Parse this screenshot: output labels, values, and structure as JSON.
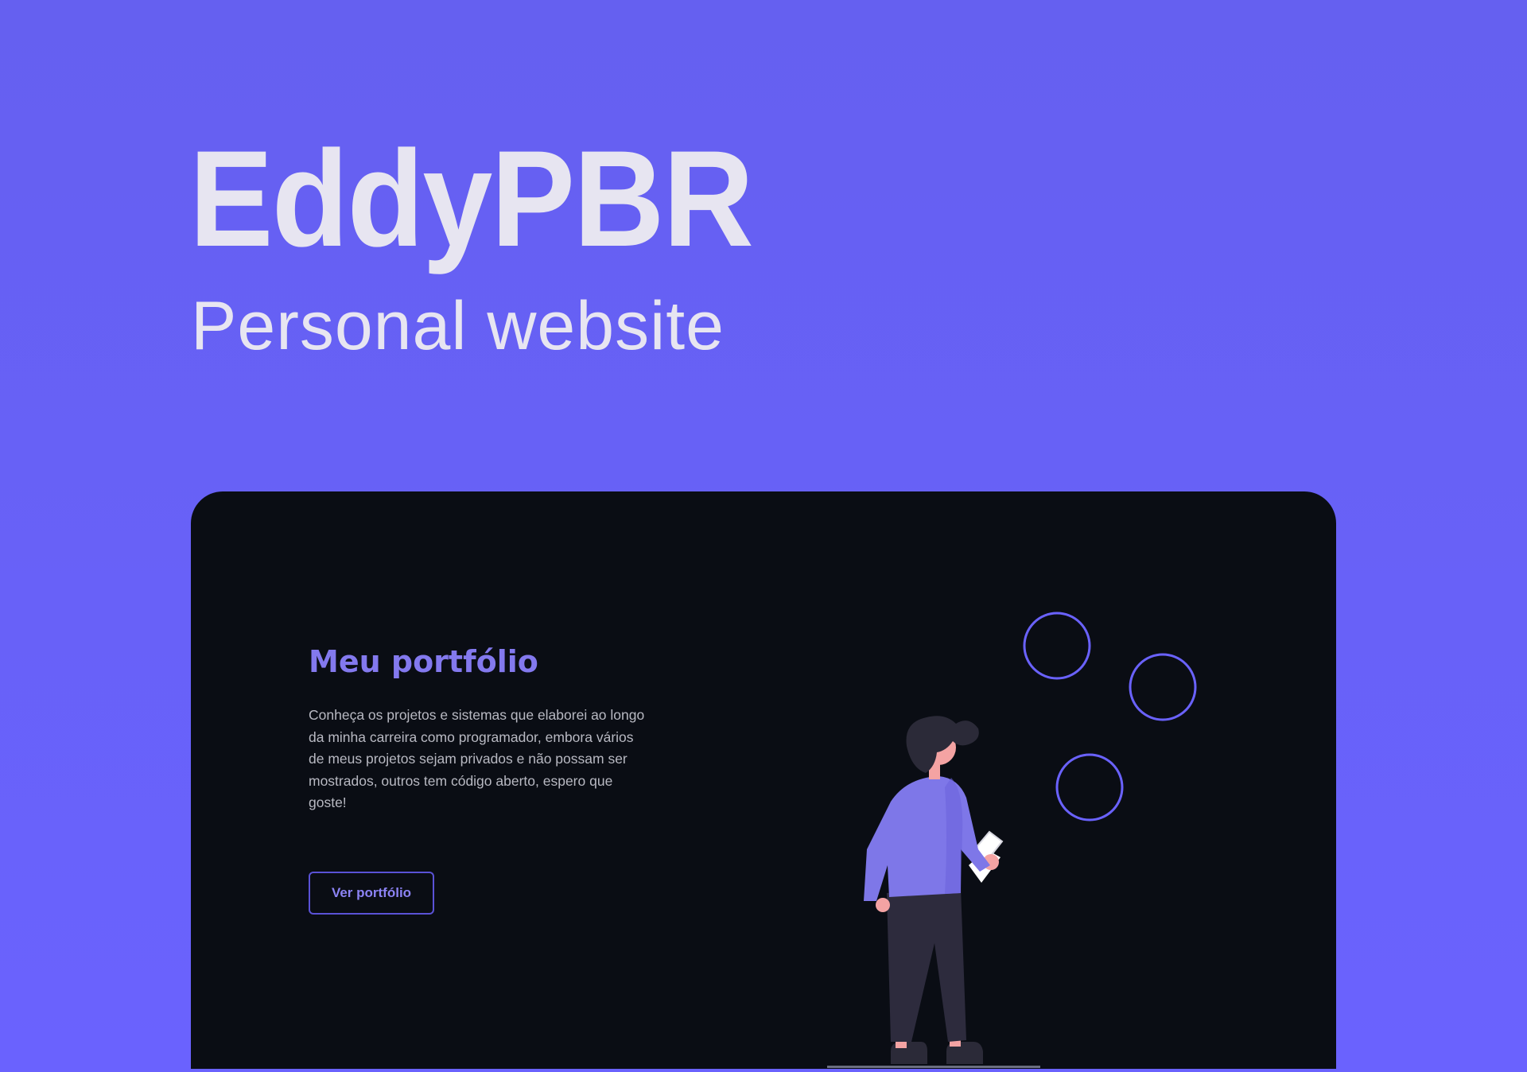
{
  "hero": {
    "title": "EddyPBR",
    "subtitle": "Personal website"
  },
  "preview": {
    "heading": "Meu portfólio",
    "description": "Conheça os projetos e sistemas que elaborei ao longo da minha carreira como programador, embora vários de meus projetos sejam privados e não possam ser mostrados, outros tem código aberto, espero que goste!",
    "button_label": "Ver portfólio"
  },
  "colors": {
    "background": "#6a62fe",
    "card": "#0a0d14",
    "accent": "#8379ee",
    "text_light": "#e7e5f1"
  },
  "icons": [
    "circle-icon",
    "person-illustration"
  ]
}
